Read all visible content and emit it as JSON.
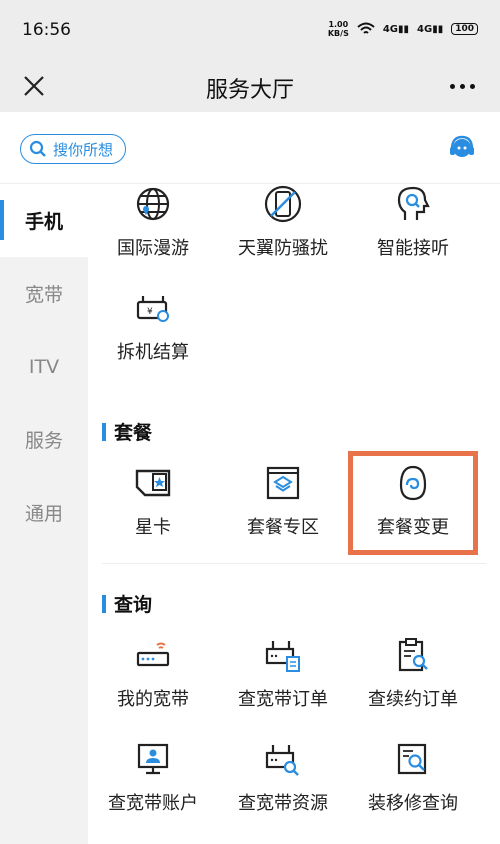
{
  "status": {
    "time": "16:56",
    "speed_value": "1.00",
    "speed_unit": "KB/S",
    "net1": "4G",
    "net2": "4G",
    "battery": "100"
  },
  "header": {
    "title": "服务大厅"
  },
  "search": {
    "placeholder": "搜你所想"
  },
  "sidebar": {
    "items": [
      {
        "label": "手机",
        "active": true
      },
      {
        "label": "宽带"
      },
      {
        "label": "ITV"
      },
      {
        "label": "服务"
      },
      {
        "label": "通用"
      }
    ]
  },
  "top_items": [
    "国际漫游",
    "天翼防骚扰",
    "智能接听",
    "拆机结算"
  ],
  "sections": [
    {
      "title": "套餐",
      "items": [
        "星卡",
        "套餐专区",
        "套餐变更"
      ]
    },
    {
      "title": "查询",
      "items": [
        "我的宽带",
        "查宽带订单",
        "查续约订单",
        "查宽带账户",
        "查宽带资源",
        "装移修查询"
      ]
    }
  ],
  "colors": {
    "accent": "#2a8de0",
    "highlight": "#e8734a"
  }
}
